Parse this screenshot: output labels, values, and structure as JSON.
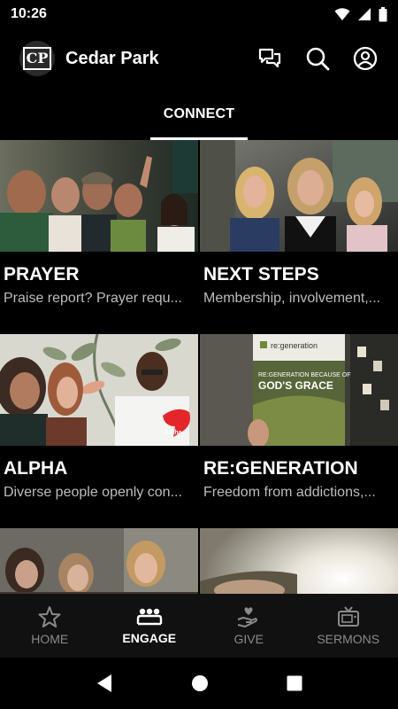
{
  "status_bar": {
    "time": "10:26"
  },
  "header": {
    "logo_text": "CP",
    "church_name": "Cedar Park"
  },
  "tabs": [
    {
      "label": "CONNECT",
      "active": true
    }
  ],
  "cards": [
    {
      "title": "PRAYER",
      "subtitle": "Praise report? Prayer requ..."
    },
    {
      "title": "NEXT STEPS",
      "subtitle": "Membership, involvement,..."
    },
    {
      "title": "ALPHA",
      "subtitle": "Diverse people openly con..."
    },
    {
      "title": "RE:GENERATION",
      "subtitle": "Freedom from addictions,..."
    },
    {
      "title": "",
      "subtitle": ""
    },
    {
      "title": "",
      "subtitle": ""
    }
  ],
  "card_image_text": {
    "alpha_badge": "Alpha",
    "regen_brand": "re:generation",
    "regen_headline_1": "RE:GENERATION BECAUSE OF",
    "regen_headline_2": "GOD'S GRACE"
  },
  "bottom_nav": [
    {
      "label": "HOME",
      "icon": "star-icon",
      "active": false
    },
    {
      "label": "ENGAGE",
      "icon": "people-icon",
      "active": true
    },
    {
      "label": "GIVE",
      "icon": "give-hand-heart-icon",
      "active": false
    },
    {
      "label": "SERMONS",
      "icon": "tv-icon",
      "active": false
    }
  ],
  "colors": {
    "background": "#000000",
    "nav_background": "#111111",
    "inactive": "#8a8a8a",
    "subtitle": "#bdbdbd",
    "alpha_red": "#e4262b"
  }
}
